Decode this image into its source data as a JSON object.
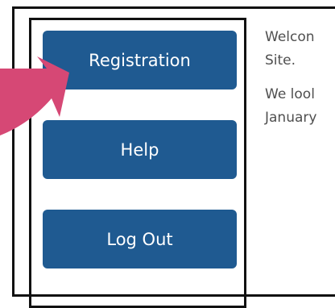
{
  "sidebar": {
    "buttons": [
      {
        "label": "Registration"
      },
      {
        "label": "Help"
      },
      {
        "label": "Log Out"
      }
    ]
  },
  "content": {
    "welcome_line1": "Welcon",
    "welcome_line2": "Site.",
    "lookforward_line1": "We lool",
    "lookforward_line2": "January"
  },
  "colors": {
    "button_bg": "#1f5a91",
    "arrow": "#d64875",
    "border": "#111111"
  },
  "icons": {
    "pointer": "arrow-icon"
  }
}
